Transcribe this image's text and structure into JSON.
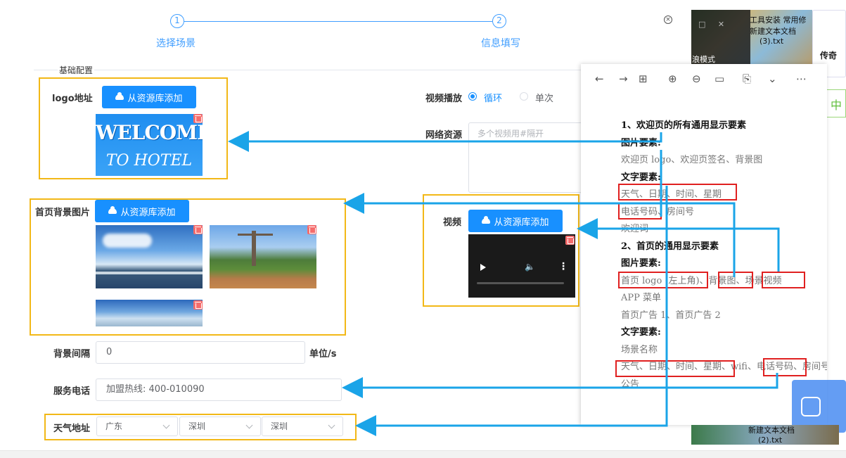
{
  "steps": [
    {
      "num": "1",
      "title": "选择场景"
    },
    {
      "num": "2",
      "title": "信息填写"
    }
  ],
  "section": {
    "title": "基础配置"
  },
  "form": {
    "logo": {
      "label": "logo地址",
      "button": "从资源库添加",
      "image_text_1": "WELCOME",
      "image_text_2": "TO HOTEL"
    },
    "background": {
      "label": "首页背景图片",
      "button": "从资源库添加"
    },
    "video_play": {
      "label": "视频播放",
      "option_loop": "循环",
      "option_once": "单次",
      "selected": "循环"
    },
    "network": {
      "label": "网络资源",
      "placeholder": "多个视频用#隔开"
    },
    "video": {
      "label": "视频",
      "button": "从资源库添加",
      "volume_glyph": "🔈",
      "more_glyph": "⋮"
    },
    "interval": {
      "label": "背景间隔",
      "value": "0",
      "unit": "单位/s"
    },
    "phone": {
      "label": "服务电话",
      "value": "加盟热线: 400-010090"
    },
    "weather": {
      "label": "天气地址",
      "province": "广东",
      "city": "深圳",
      "district": "深圳"
    }
  },
  "doc": {
    "toolbar": [
      "←",
      "→",
      "⊞",
      "⊕",
      "⊖",
      "▭",
      "⎘",
      "⌄",
      "⋯"
    ],
    "lines": [
      {
        "text": "1、欢迎页的所有通用显示要素",
        "style": "h"
      },
      {
        "text": "图片要素:",
        "style": "h"
      },
      {
        "text": "欢迎页 logo、欢迎页签名、背景图",
        "style": "g"
      },
      {
        "text": "文字要素:",
        "style": "h"
      },
      {
        "text": "天气、日期、时间、星期",
        "style": "g"
      },
      {
        "text": "电话号码、房间号",
        "style": "g"
      },
      {
        "text": "欢迎词",
        "style": "g"
      },
      {
        "text": "2、首页的通用显示要素",
        "style": "h"
      },
      {
        "text": "图片要素:",
        "style": "h"
      },
      {
        "text": "首页 logo (左上角)、背景图、场景视频",
        "style": "g"
      },
      {
        "text": "APP 菜单",
        "style": "g"
      },
      {
        "text": "首页广告 1、首页广告 2",
        "style": "g"
      },
      {
        "text": "文字要素:",
        "style": "h"
      },
      {
        "text": "场景名称",
        "style": "g"
      },
      {
        "text": "天气、日期、时间、星期、wifi、电话号码、房间号",
        "style": "g"
      },
      {
        "text": "公告",
        "style": "g"
      }
    ]
  },
  "desktop": {
    "label_top": "工具安装 常用修",
    "label_doc": "新建文本文档",
    "label_mode": "浪模式",
    "label_right": "传奇",
    "label_side": "中",
    "label_file": "(3).txt",
    "label_bottom": "新建文本文档",
    "label_bottom_file": "(2).txt"
  },
  "colors": {
    "accent": "#1890ff",
    "highlight_box": "#f2b817",
    "doc_box": "#e02020",
    "arrow": "#1aa4e8"
  }
}
